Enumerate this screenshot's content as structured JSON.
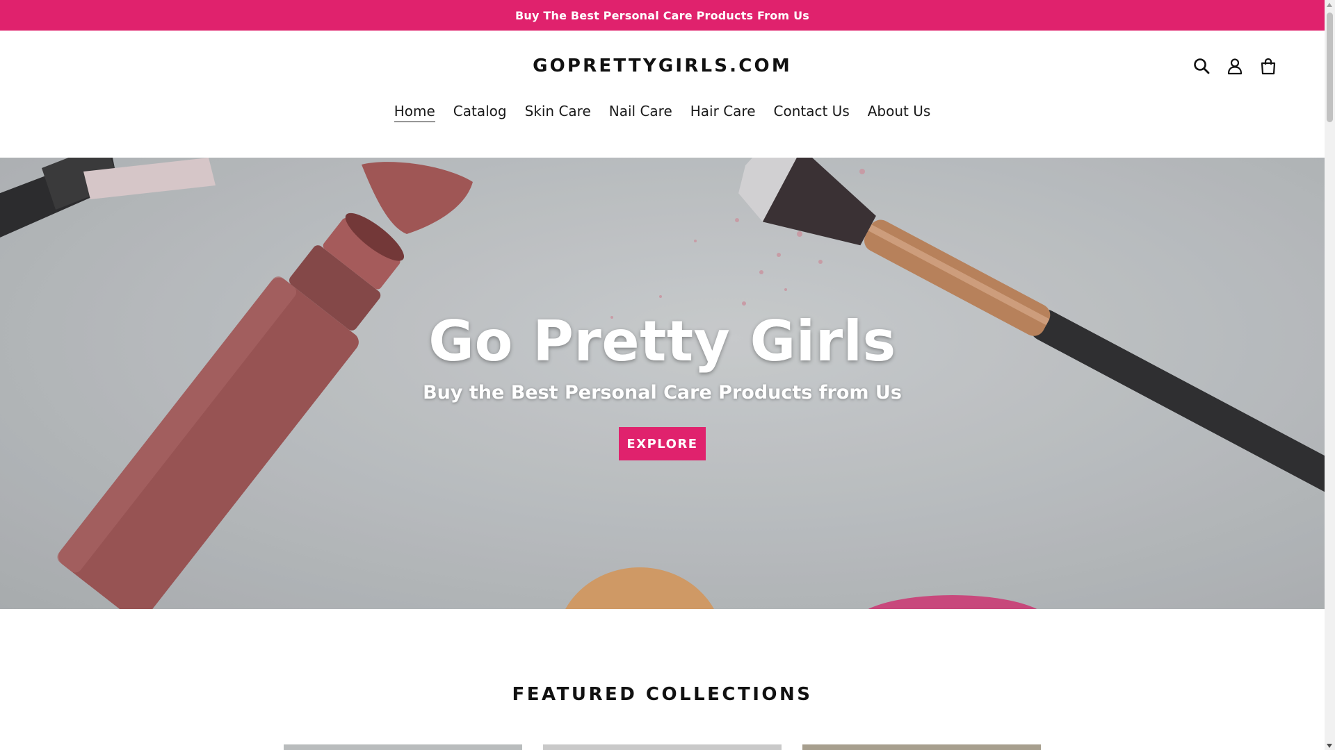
{
  "announcement": {
    "text": "Buy The Best Personal Care Products From Us"
  },
  "header": {
    "logo": "GOPRETTYGIRLS.COM",
    "icons": [
      "search-icon",
      "account-icon",
      "cart-icon"
    ]
  },
  "nav": {
    "items": [
      {
        "label": "Home",
        "active": true
      },
      {
        "label": "Catalog"
      },
      {
        "label": "Skin Care"
      },
      {
        "label": "Nail Care"
      },
      {
        "label": "Hair Care"
      },
      {
        "label": "Contact Us"
      },
      {
        "label": "About Us"
      }
    ]
  },
  "hero": {
    "title": "Go Pretty Girls",
    "subtitle": "Buy the Best Personal Care Products from Us",
    "button": "EXPLORE"
  },
  "featured": {
    "title": "FEATURED COLLECTIONS"
  },
  "colors": {
    "accent": "#e0226d"
  }
}
